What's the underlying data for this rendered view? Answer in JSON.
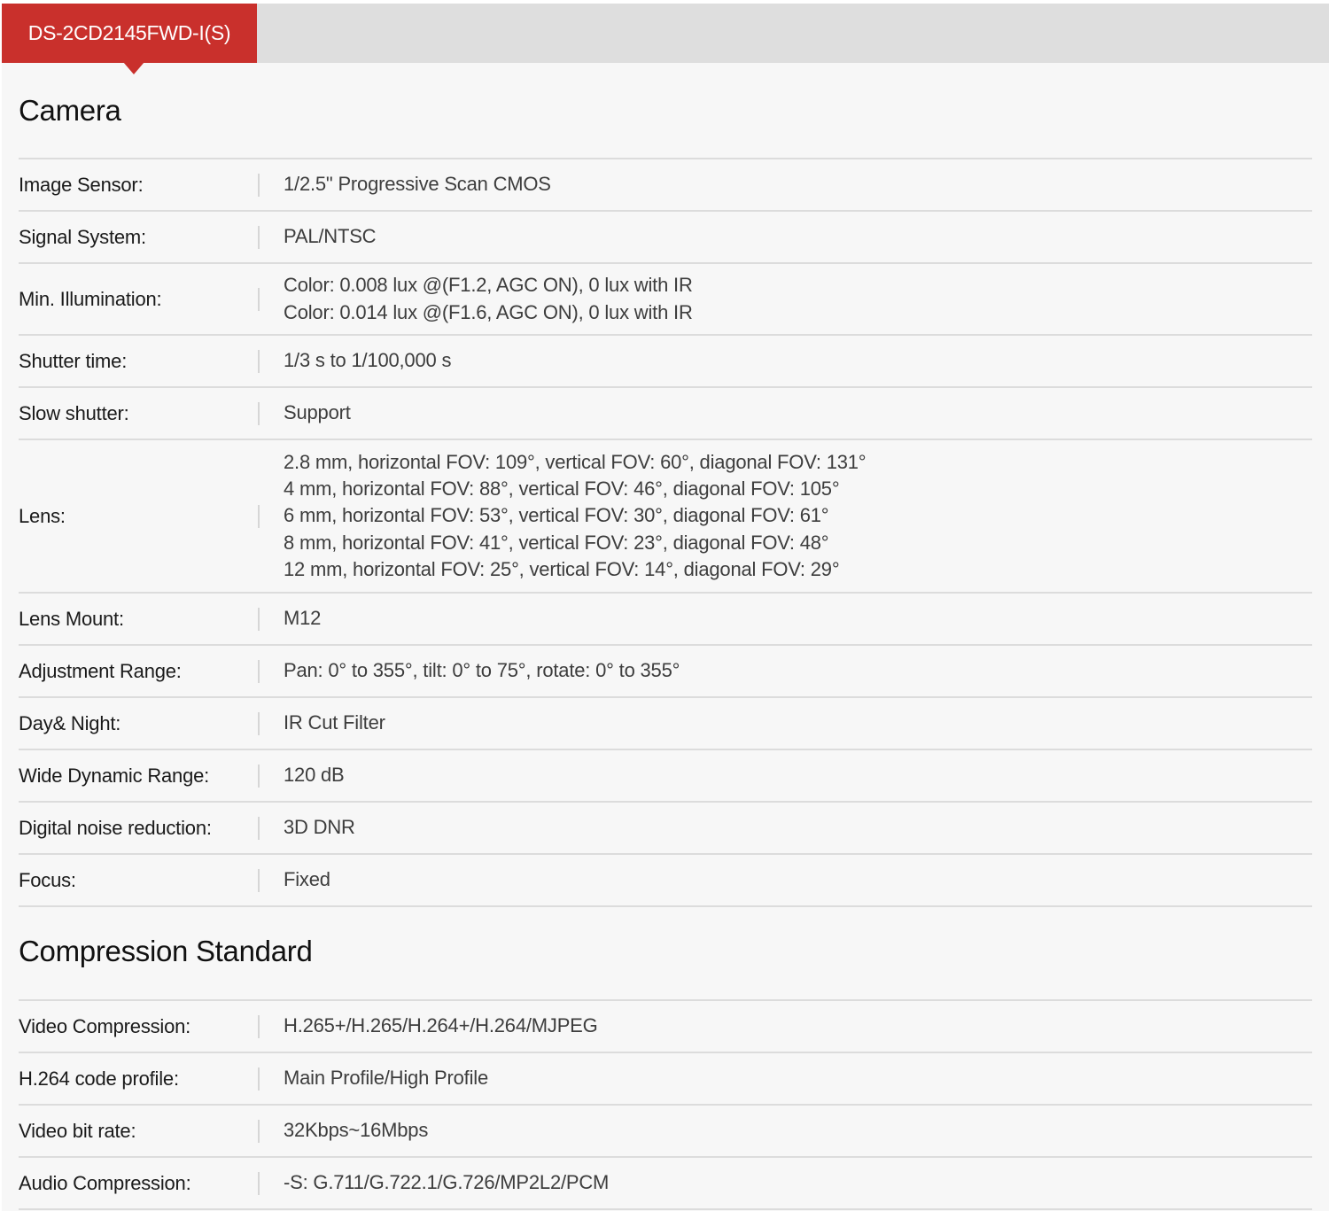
{
  "tab": {
    "label": "DS-2CD2145FWD-I(S)"
  },
  "sections": [
    {
      "title": "Camera",
      "rows": [
        {
          "label": "Image Sensor:",
          "value": [
            "1/2.5\" Progressive Scan CMOS"
          ]
        },
        {
          "label": "Signal System:",
          "value": [
            "PAL/NTSC"
          ]
        },
        {
          "label": "Min. Illumination:",
          "value": [
            "Color: 0.008 lux @(F1.2, AGC ON), 0 lux with IR",
            "Color: 0.014 lux @(F1.6, AGC ON), 0 lux with IR"
          ]
        },
        {
          "label": "Shutter time:",
          "value": [
            "1/3 s to 1/100,000 s"
          ]
        },
        {
          "label": "Slow shutter:",
          "value": [
            "Support"
          ]
        },
        {
          "label": "Lens:",
          "value": [
            "2.8 mm, horizontal FOV: 109°, vertical FOV: 60°, diagonal FOV: 131°",
            "4 mm, horizontal FOV: 88°, vertical FOV: 46°, diagonal FOV: 105°",
            "6 mm, horizontal FOV: 53°, vertical FOV: 30°, diagonal FOV: 61°",
            "8 mm, horizontal FOV: 41°, vertical FOV: 23°, diagonal FOV: 48°",
            "12 mm, horizontal FOV: 25°, vertical FOV: 14°, diagonal FOV: 29°"
          ]
        },
        {
          "label": "Lens Mount:",
          "value": [
            "M12"
          ]
        },
        {
          "label": "Adjustment Range:",
          "value": [
            "Pan: 0° to 355°, tilt: 0° to 75°, rotate: 0° to 355°"
          ]
        },
        {
          "label": "Day& Night:",
          "value": [
            "IR Cut Filter"
          ]
        },
        {
          "label": "Wide Dynamic Range:",
          "value": [
            "120 dB"
          ]
        },
        {
          "label": "Digital noise reduction:",
          "value": [
            "3D DNR"
          ]
        },
        {
          "label": "Focus:",
          "value": [
            "Fixed"
          ]
        }
      ]
    },
    {
      "title": "Compression Standard",
      "rows": [
        {
          "label": "Video Compression:",
          "value": [
            "H.265+/H.265/H.264+/H.264/MJPEG"
          ]
        },
        {
          "label": "H.264 code profile:",
          "value": [
            "Main Profile/High Profile"
          ]
        },
        {
          "label": "Video bit rate:",
          "value": [
            "32Kbps~16Mbps"
          ]
        },
        {
          "label": "Audio Compression:",
          "value": [
            "-S: G.711/G.722.1/G.726/MP2L2/PCM"
          ]
        }
      ]
    }
  ]
}
